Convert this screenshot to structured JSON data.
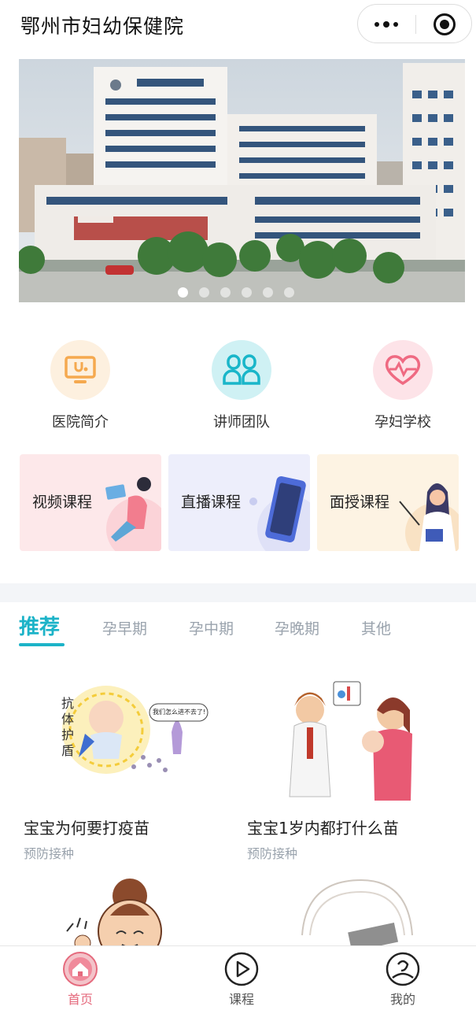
{
  "header": {
    "title": "鄂州市妇幼保健院"
  },
  "banner": {
    "slide_count": 6,
    "active_slide": 1
  },
  "features": [
    {
      "label": "医院简介",
      "icon": "monitor-stethoscope-icon",
      "color": "#f5a94f"
    },
    {
      "label": "讲师团队",
      "icon": "team-icon",
      "color": "#19b6c9"
    },
    {
      "label": "孕妇学校",
      "icon": "heart-pulse-icon",
      "color": "#ef6a82"
    }
  ],
  "courses": [
    {
      "label": "视频课程",
      "bg": "#fde8ea"
    },
    {
      "label": "直播课程",
      "bg": "#edeefb"
    },
    {
      "label": "面授课程",
      "bg": "#fdf3e3"
    }
  ],
  "tabs": [
    {
      "label": "推荐",
      "active": true
    },
    {
      "label": "孕早期"
    },
    {
      "label": "孕中期"
    },
    {
      "label": "孕晚期"
    },
    {
      "label": "其他"
    }
  ],
  "articles": [
    {
      "title": "宝宝为何要打疫苗",
      "category": "预防接种",
      "image_text": [
        "抗",
        "体",
        "护",
        "盾"
      ],
      "bubble_text": "我们怎么进不去了!"
    },
    {
      "title": "宝宝1岁内都打什么苗",
      "category": "预防接种"
    }
  ],
  "tabbar": [
    {
      "label": "首页",
      "icon": "home-icon",
      "active": true
    },
    {
      "label": "课程",
      "icon": "play-circle-icon"
    },
    {
      "label": "我的",
      "icon": "profile-icon"
    }
  ],
  "colors": {
    "accent": "#1cb3c8",
    "tab_active": "#e56a7d",
    "inactive": "#9aa3ad"
  }
}
